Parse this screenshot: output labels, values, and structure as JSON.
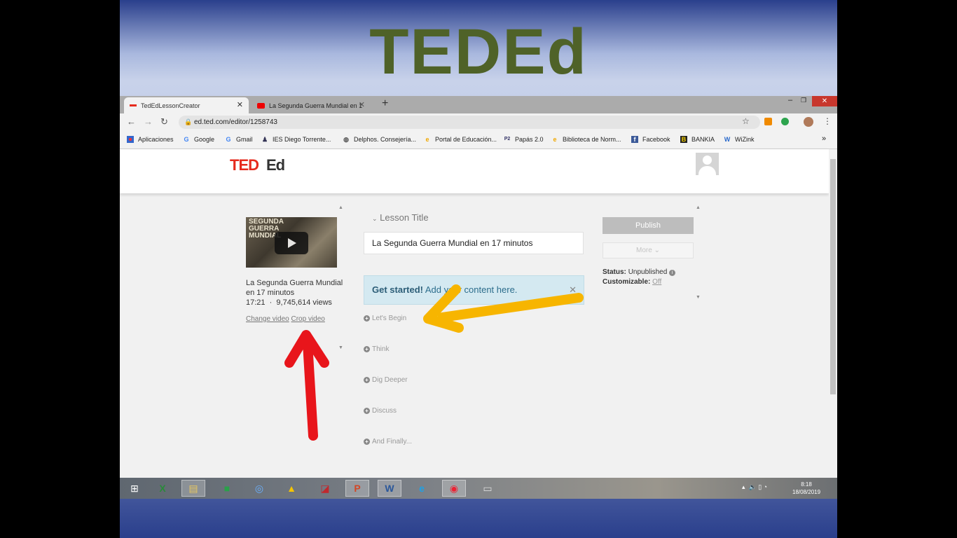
{
  "slide": {
    "title": "TEDEd"
  },
  "browser": {
    "tabs": [
      {
        "label": "TedEdLessonCreator",
        "active": true
      },
      {
        "label": "La Segunda Guerra Mundial en 1",
        "active": false
      }
    ],
    "new_tab": "+",
    "url": "ed.ted.com/editor/1258743",
    "bookmarks": [
      {
        "label": "Aplicaciones",
        "icon": "apps-icon"
      },
      {
        "label": "Google",
        "icon": "google-icon"
      },
      {
        "label": "Gmail",
        "icon": "google-icon"
      },
      {
        "label": "IES Diego Torrente...",
        "icon": "person-icon"
      },
      {
        "label": "Delphos. Consejería...",
        "icon": "globe-icon"
      },
      {
        "label": "Portal de Educación...",
        "icon": "ie-icon"
      },
      {
        "label": "Papás 2.0",
        "icon": "p2-icon"
      },
      {
        "label": "Biblioteca de Norm...",
        "icon": "ie-icon"
      },
      {
        "label": "Facebook",
        "icon": "facebook-icon"
      },
      {
        "label": "BANKIA",
        "icon": "bankia-icon"
      },
      {
        "label": "WiZink",
        "icon": "wizink-icon"
      }
    ],
    "bookmarks_overflow": "»"
  },
  "page": {
    "logo_ted": "TED",
    "logo_ed": "Ed",
    "video": {
      "thumb_caption": "SEGUNDA GUERRA MUNDIAL",
      "title": "La Segunda Guerra Mundial en 17 minutos",
      "duration": "17:21",
      "views": "9,745,614 views",
      "change_label": "Change video",
      "crop_label": "Crop video"
    },
    "lesson_title_label": "Lesson Title",
    "lesson_title_value": "La Segunda Guerra Mundial en 17 minutos",
    "get_started_bold": "Get started!",
    "get_started_text": "Add your content here.",
    "sections": [
      "Let's Begin",
      "Think",
      "Dig Deeper",
      "Discuss",
      "And Finally..."
    ],
    "publish_label": "Publish",
    "more_label": "More",
    "status_label": "Status:",
    "status_value": "Unpublished",
    "customizable_label": "Customizable:",
    "customizable_value": "Off"
  },
  "taskbar": {
    "time": "8:18",
    "date": "18/08/2019"
  },
  "colors": {
    "ted_red": "#e62b1e",
    "slide_title": "#4f6228",
    "arrow_yellow": "#f7b500",
    "arrow_red": "#e8151b"
  }
}
